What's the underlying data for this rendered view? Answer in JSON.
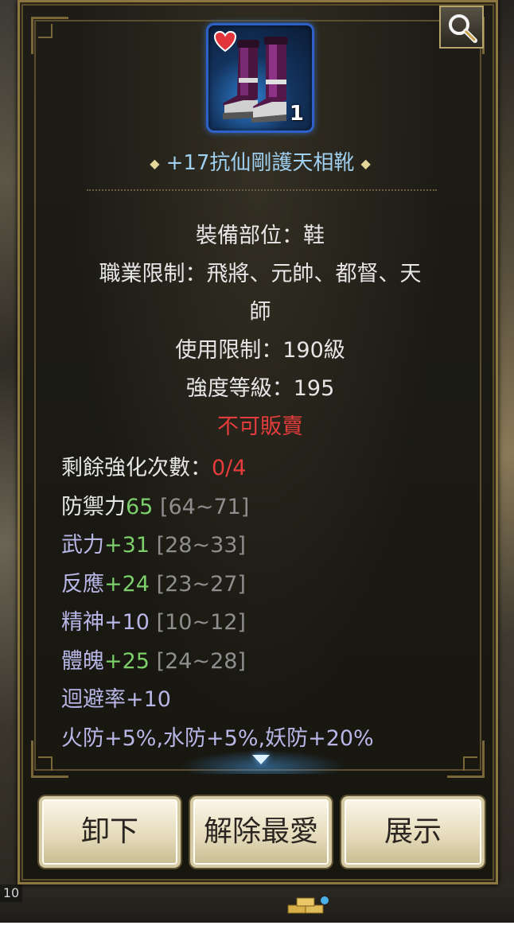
{
  "background": {
    "bottom_left_level": "10"
  },
  "panel": {
    "search_icon": "magnifier-icon",
    "item": {
      "icon": "purple-boots-icon",
      "favorite_icon": "heart-icon",
      "count": "1",
      "name": "+17抗仙剛護天相靴",
      "name_color": "#9fd0f0"
    },
    "info": {
      "slot": "裝備部位：鞋",
      "job_line1": "職業限制：飛將、元帥、都督、天",
      "job_line2": "師",
      "level_req": "使用限制：190級",
      "strength": "強度等級：195",
      "not_sellable": "不可販賣"
    },
    "stats": {
      "enhance_label": "剩餘強化次數：",
      "enhance_value": "0/4",
      "defense_label": "防禦力",
      "defense_value": "65",
      "defense_range": " [64~71]",
      "power_label": "武力",
      "power_value": "+31",
      "power_range": " [28~33]",
      "react_label": "反應",
      "react_value": "+24",
      "react_range": " [23~27]",
      "spirit_label": "精神+10",
      "spirit_range": " [10~12]",
      "body_label": "體魄",
      "body_value": "+25",
      "body_range": " [24~28]",
      "evade": "迴避率+10",
      "resist": "火防+5%,水防+5%,妖防+20%"
    },
    "buttons": {
      "unequip": "卸下",
      "unfavorite": "解除最愛",
      "show": "展示"
    },
    "colors": {
      "red": "#e53c3c",
      "green": "#7ccf6a",
      "lavender": "#b8b6e6",
      "grey": "#8e8e8e"
    }
  }
}
